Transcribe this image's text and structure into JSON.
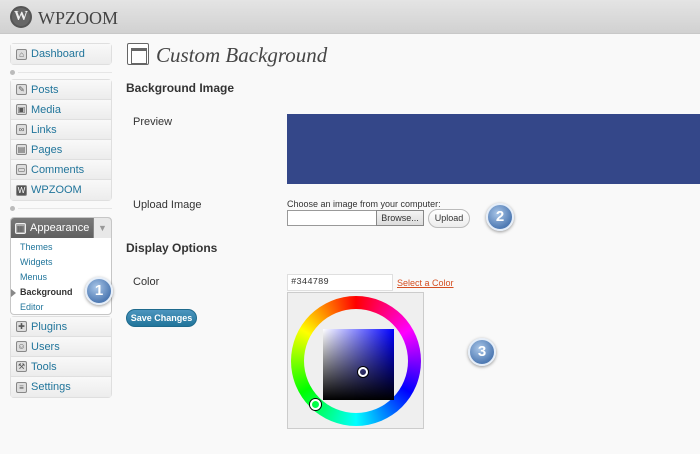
{
  "header": {
    "site_name": "WPZOOM",
    "logo_letter": "W"
  },
  "sidebar": {
    "top_items": [
      {
        "label": "Dashboard",
        "icon": "home-icon"
      }
    ],
    "mid_items": [
      {
        "label": "Posts",
        "icon": "pin-icon"
      },
      {
        "label": "Media",
        "icon": "media-icon"
      },
      {
        "label": "Links",
        "icon": "link-icon"
      },
      {
        "label": "Pages",
        "icon": "page-icon"
      },
      {
        "label": "Comments",
        "icon": "comment-icon"
      },
      {
        "label": "WPZOOM",
        "icon": "wpzoom-icon"
      }
    ],
    "appearance": {
      "label": "Appearance",
      "submenu": [
        "Themes",
        "Widgets",
        "Menus",
        "Background",
        "Editor"
      ],
      "current": "Background"
    },
    "bottom_items": [
      {
        "label": "Plugins",
        "icon": "plugin-icon"
      },
      {
        "label": "Users",
        "icon": "users-icon"
      },
      {
        "label": "Tools",
        "icon": "tools-icon"
      },
      {
        "label": "Settings",
        "icon": "settings-icon"
      }
    ]
  },
  "main": {
    "title": "Custom Background",
    "background_image_heading": "Background Image",
    "preview_label": "Preview",
    "preview_color": "#344789",
    "upload_label": "Upload Image",
    "upload_hint": "Choose an image from your computer:",
    "browse_label": "Browse...",
    "upload_button": "Upload",
    "display_options_heading": "Display Options",
    "color_label": "Color",
    "color_value": "#344789",
    "select_color_link": "Select a Color",
    "save_button": "Save Changes"
  },
  "callouts": [
    "1",
    "2",
    "3"
  ]
}
